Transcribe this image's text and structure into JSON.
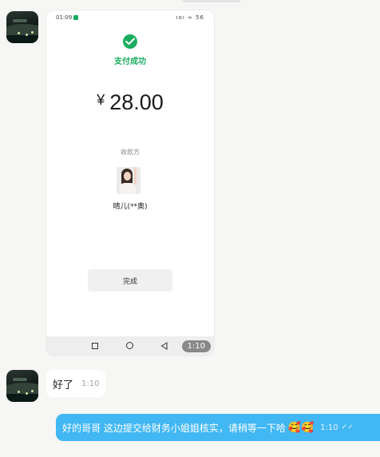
{
  "screenshot": {
    "status_time": "01:09",
    "status_icons": "ıoı ≈ 56",
    "success_text": "支付成功",
    "currency": "¥",
    "amount": "28.00",
    "payee_label": "收款方",
    "payee_name": "晴儿(**奥)",
    "done_label": "完成",
    "message_time": "1:10"
  },
  "incoming": {
    "text": "好了",
    "time": "1:10"
  },
  "outgoing": {
    "text": "好的哥哥 这边提交给财务小姐姐核实，请稍等一下哈",
    "emoji": "🥰🥰",
    "time": "1:10",
    "read_mark": "✓✓"
  },
  "colors": {
    "wechat_green": "#1aad5f",
    "outgoing_bubble": "#41b7f3",
    "background": "#f6f6f4"
  },
  "icons": [
    "contact-avatar",
    "wechat-pay-check-icon",
    "nav-recent-icon",
    "nav-home-icon",
    "nav-back-icon"
  ]
}
